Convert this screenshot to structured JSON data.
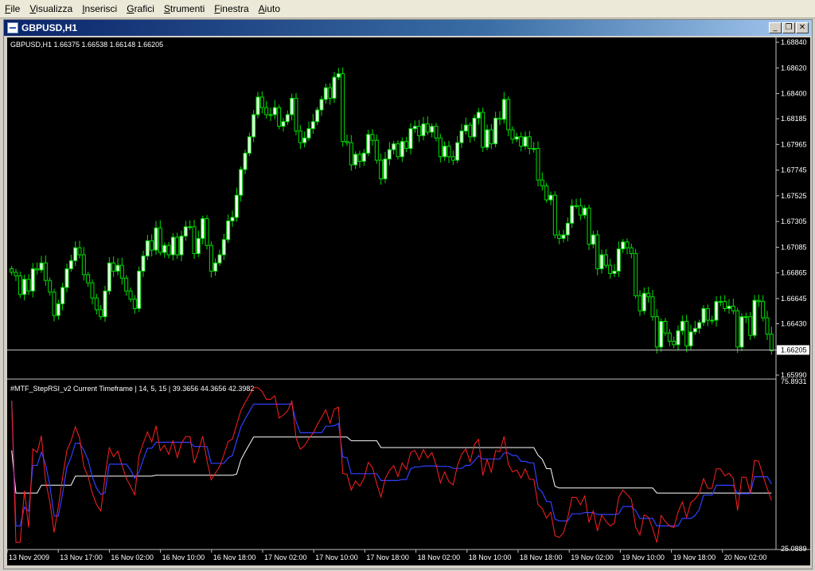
{
  "menu": [
    "File",
    "Visualizza",
    "Inserisci",
    "Grafici",
    "Strumenti",
    "Finestra",
    "Aiuto"
  ],
  "window": {
    "title": "GBPUSD,H1",
    "buttons": {
      "minimize": "_",
      "restore": "❐",
      "close": "✕"
    }
  },
  "chart_data": [
    {
      "type": "candlestick",
      "header": "GBPUSD,H1  1.66375 1.66538 1.66148 1.66205",
      "y_ticks": [
        "1.68840",
        "1.68620",
        "1.68400",
        "1.68185",
        "1.67965",
        "1.67745",
        "1.67525",
        "1.67305",
        "1.67085",
        "1.66865",
        "1.66645",
        "1.66430",
        "1.66205",
        "1.65990"
      ],
      "ylim": [
        1.6599,
        1.6884
      ],
      "current_price": 1.66205,
      "closes": [
        1.6687,
        1.6684,
        1.6668,
        1.6681,
        1.6671,
        1.669,
        1.6689,
        1.6695,
        1.668,
        1.667,
        1.665,
        1.666,
        1.6674,
        1.669,
        1.6697,
        1.6708,
        1.6702,
        1.6685,
        1.6678,
        1.6665,
        1.6655,
        1.6649,
        1.6671,
        1.6695,
        1.6688,
        1.6693,
        1.6682,
        1.6671,
        1.6664,
        1.6656,
        1.6688,
        1.6701,
        1.6714,
        1.6706,
        1.6725,
        1.6704,
        1.671,
        1.6702,
        1.6717,
        1.6702,
        1.6718,
        1.6726,
        1.6726,
        1.6703,
        1.6716,
        1.6733,
        1.671,
        1.6688,
        1.6695,
        1.6702,
        1.6715,
        1.6731,
        1.6734,
        1.6753,
        1.6775,
        1.6789,
        1.6803,
        1.6822,
        1.6837,
        1.6828,
        1.6822,
        1.6822,
        1.6828,
        1.6812,
        1.6816,
        1.6822,
        1.6836,
        1.6808,
        1.6798,
        1.6802,
        1.681,
        1.6816,
        1.6826,
        1.6835,
        1.6845,
        1.6836,
        1.6854,
        1.6857,
        1.6799,
        1.6798,
        1.6779,
        1.6788,
        1.6782,
        1.6789,
        1.6805,
        1.68,
        1.6783,
        1.6767,
        1.6784,
        1.6792,
        1.6797,
        1.6786,
        1.6799,
        1.6793,
        1.681,
        1.6812,
        1.6804,
        1.6814,
        1.6807,
        1.6812,
        1.6802,
        1.6786,
        1.6795,
        1.6786,
        1.6783,
        1.6798,
        1.6808,
        1.6813,
        1.6803,
        1.6819,
        1.6824,
        1.6794,
        1.6809,
        1.6797,
        1.6819,
        1.6818,
        1.6835,
        1.6809,
        1.6801,
        1.6803,
        1.6795,
        1.6803,
        1.6793,
        1.6793,
        1.6766,
        1.6761,
        1.6749,
        1.6753,
        1.6719,
        1.6716,
        1.6719,
        1.6729,
        1.6744,
        1.6744,
        1.6736,
        1.6742,
        1.6711,
        1.6719,
        1.669,
        1.6702,
        1.6693,
        1.6686,
        1.6688,
        1.6707,
        1.6713,
        1.6708,
        1.6703,
        1.6667,
        1.6654,
        1.6669,
        1.6666,
        1.6649,
        1.6623,
        1.6645,
        1.6635,
        1.6628,
        1.6625,
        1.6637,
        1.6645,
        1.6624,
        1.6636,
        1.6639,
        1.6644,
        1.6656,
        1.6646,
        1.6646,
        1.6662,
        1.6662,
        1.6656,
        1.6658,
        1.6654,
        1.6623,
        1.6649,
        1.6649,
        1.6633,
        1.6663,
        1.6662,
        1.6648,
        1.6634,
        1.662
      ]
    },
    {
      "type": "line",
      "header": "#MTF_StepRSI_v2 Current Timeframe | 14, 5, 15 |  39.3656 44.3656 42.3982",
      "y_ticks": [
        "75.8931",
        "25.0889"
      ],
      "ylim": [
        25.0889,
        75.8931
      ],
      "series_colors": {
        "rsi": "#ff2020",
        "fast_step": "#3040ff",
        "slow_step": "#ffffff"
      }
    }
  ],
  "x_ticks": [
    "13 Nov 2009",
    "13 Nov 17:00",
    "16 Nov 02:00",
    "16 Nov 10:00",
    "16 Nov 18:00",
    "17 Nov 02:00",
    "17 Nov 10:00",
    "17 Nov 18:00",
    "18 Nov 02:00",
    "18 Nov 10:00",
    "18 Nov 18:00",
    "19 Nov 02:00",
    "19 Nov 10:00",
    "19 Nov 18:00",
    "20 Nov 02:00"
  ]
}
